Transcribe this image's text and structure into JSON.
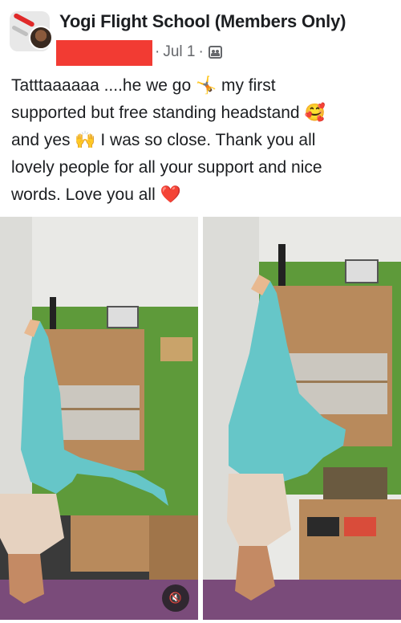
{
  "group": {
    "name": "Yogi Flight School (Members Only)"
  },
  "post": {
    "date": "Jul 1",
    "separator": "·",
    "lines": [
      "Tatttaaaaaa ....he we go 🤸 my first",
      "supported but free standing headstand 🥰",
      "and yes 🙌 I was so close. Thank you all",
      "lovely people for all your support and nice",
      "words. Love you all ❤️"
    ]
  },
  "media": {
    "count": 2,
    "mute_icon": "speaker-muted-icon",
    "mute_glyph": "🔇"
  },
  "colors": {
    "wall_green": "#5e9a3a",
    "leggings": "#66c6c8",
    "cabinet": "#b88a5c",
    "mat": "#7a4b7a",
    "redaction": "#f23b33",
    "meta_gray": "#65676b"
  }
}
